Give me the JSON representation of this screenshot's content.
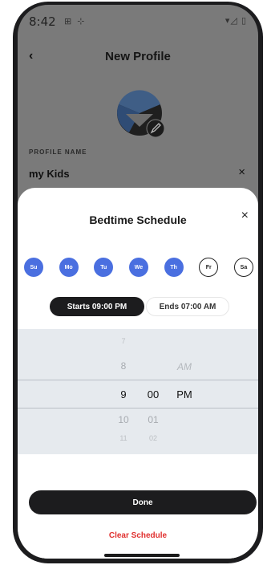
{
  "status": {
    "time": "8:42",
    "left_icons": "⊞ ⊹",
    "right_icons": "▾◿ ▯"
  },
  "header": {
    "back_glyph": "‹",
    "title": "New Profile"
  },
  "profile": {
    "label": "PROFILE NAME",
    "name": "my Kids",
    "clear_glyph": "×"
  },
  "sheet": {
    "title": "Bedtime Schedule",
    "close_glyph": "×",
    "days": [
      {
        "label": "Su",
        "selected": true
      },
      {
        "label": "Mo",
        "selected": true
      },
      {
        "label": "Tu",
        "selected": true
      },
      {
        "label": "We",
        "selected": true
      },
      {
        "label": "Th",
        "selected": true
      },
      {
        "label": "Fr",
        "selected": false
      },
      {
        "label": "Sa",
        "selected": false
      }
    ],
    "start_label": "Starts 09:00 PM",
    "end_label": "Ends 07:00 AM",
    "picker": {
      "hours": [
        "7",
        "8",
        "9",
        "10",
        "11"
      ],
      "minutes": [
        "",
        "",
        "00",
        "01",
        "02"
      ],
      "period": [
        "",
        "AM",
        "PM",
        "",
        ""
      ]
    },
    "done_label": "Done",
    "clear_label": "Clear Schedule"
  },
  "colors": {
    "accent": "#4a6fe0",
    "danger": "#e0302f",
    "dark": "#1c1c1e"
  }
}
